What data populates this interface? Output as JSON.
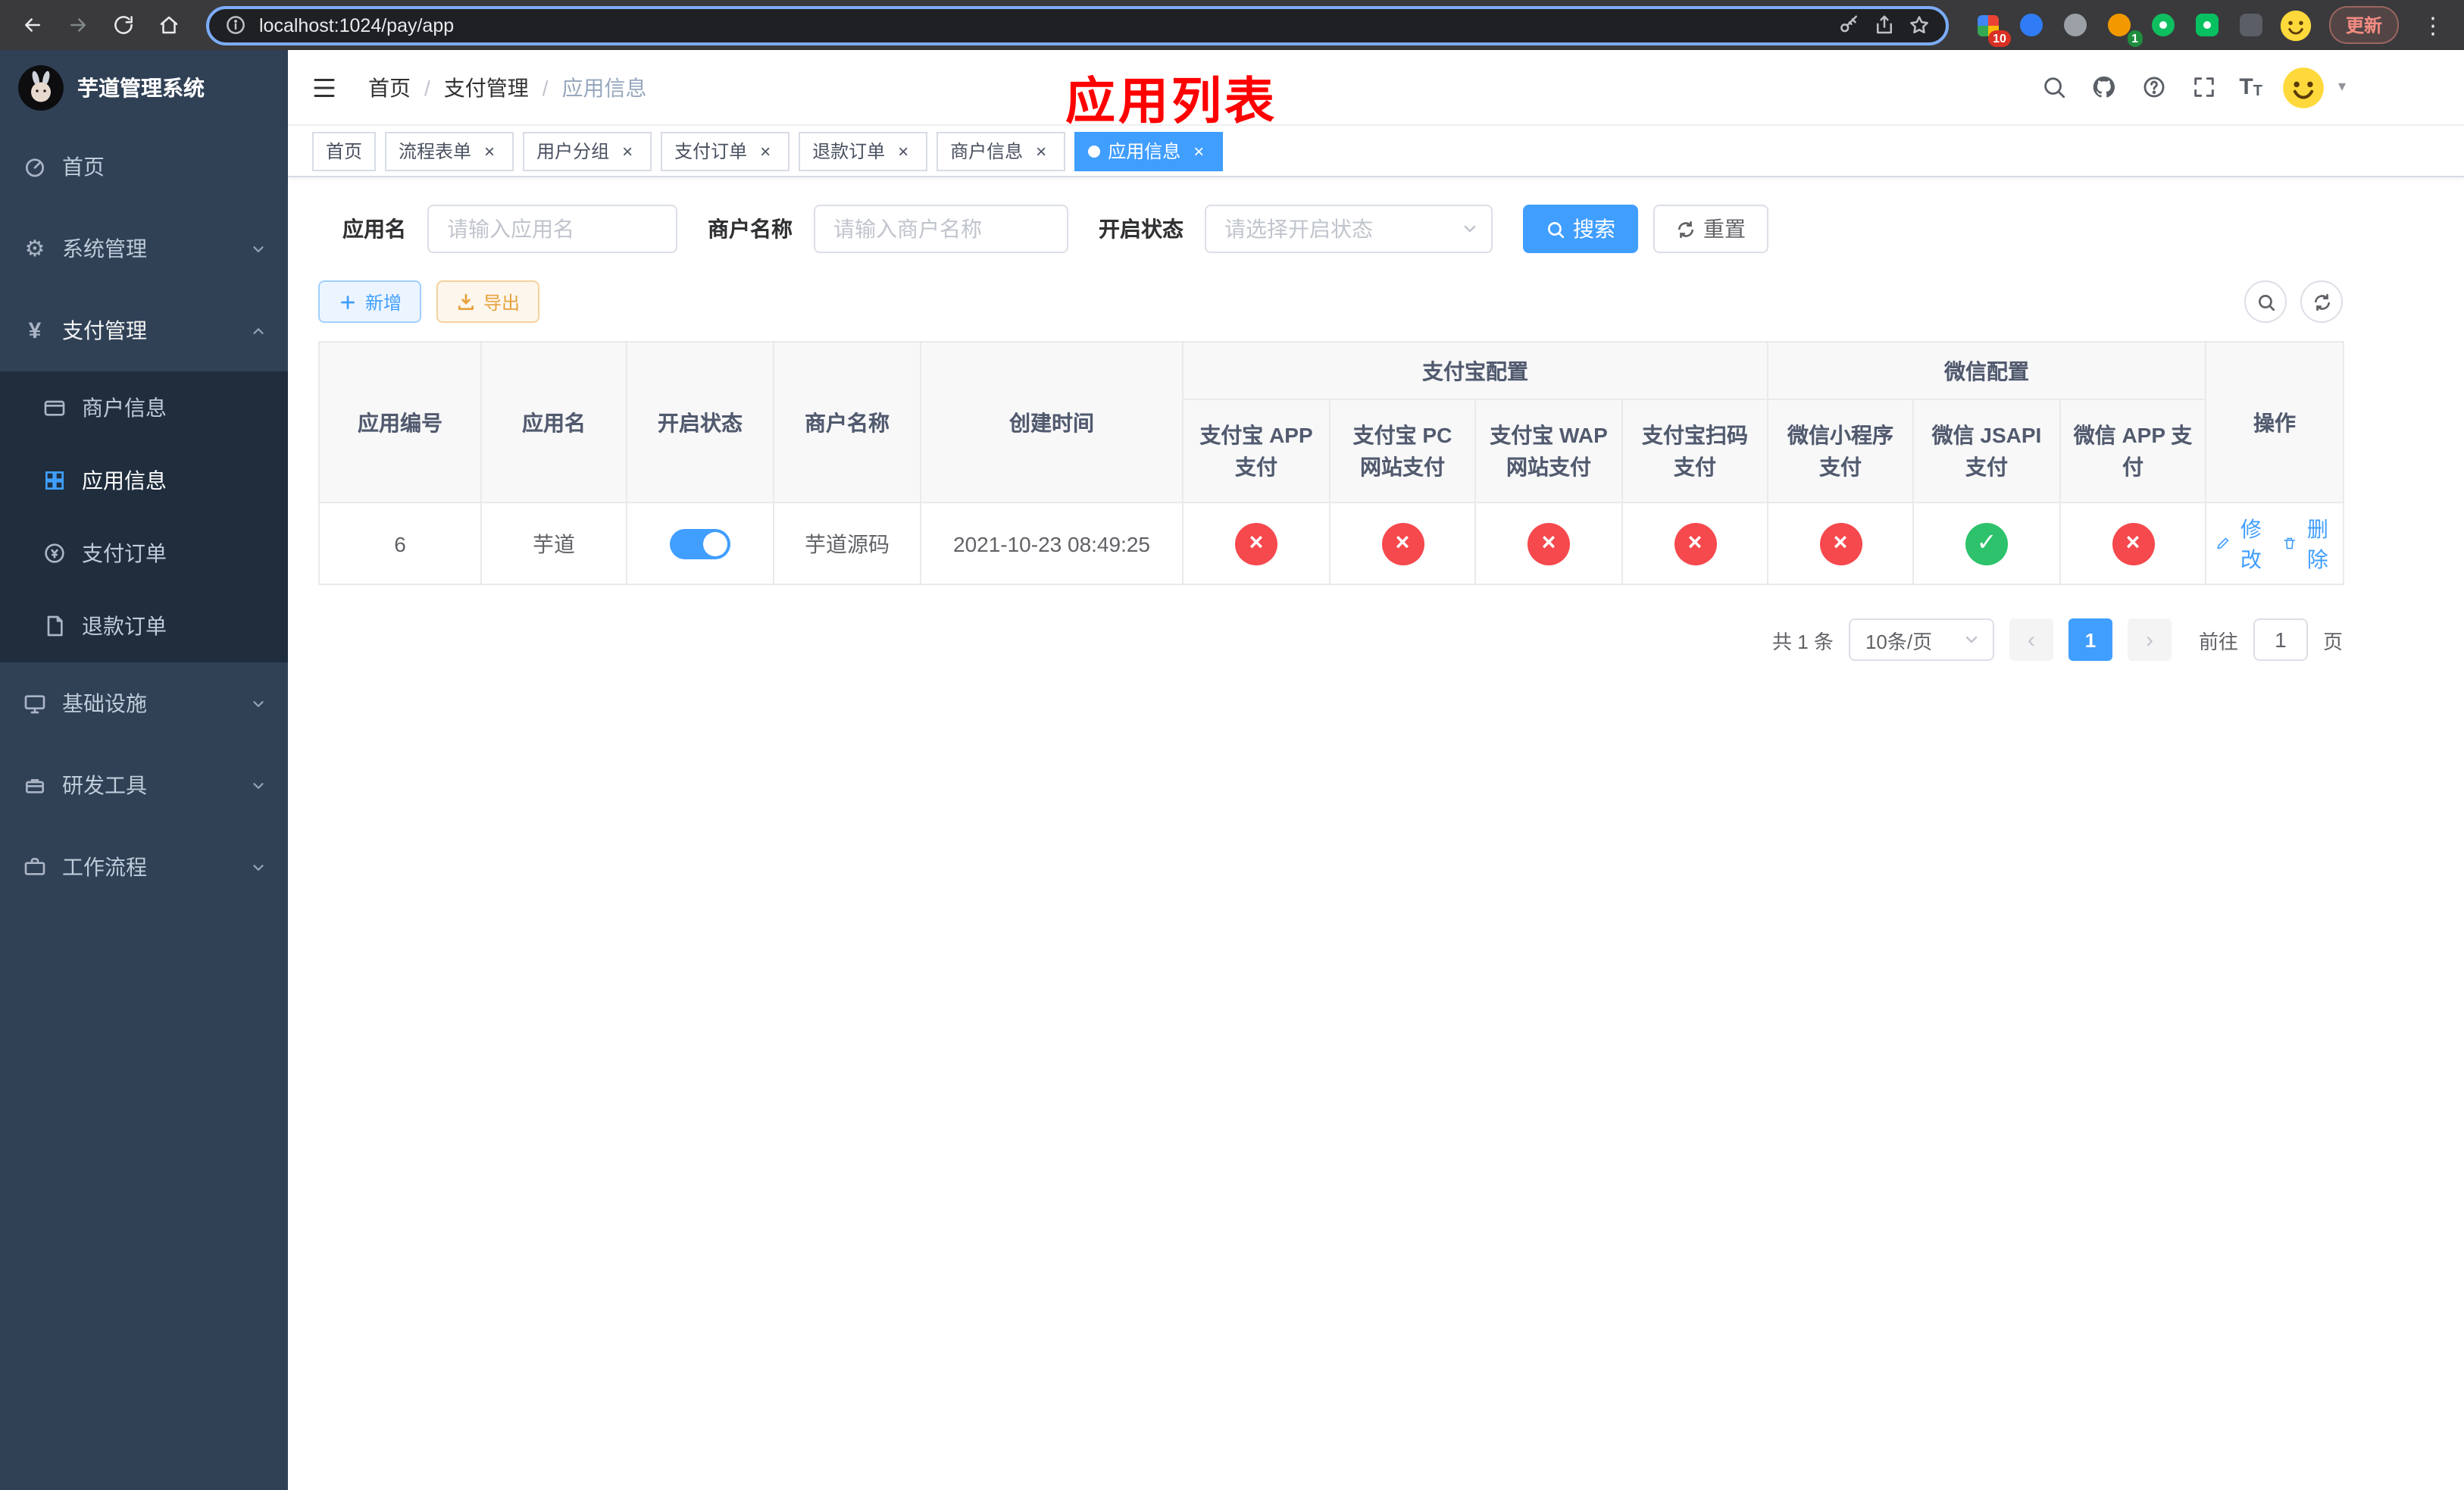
{
  "colors": {
    "primary": "#409eff",
    "danger": "#f5494d",
    "success": "#2dc26b",
    "warning": "#e6a23c",
    "title_red": "#ff0000",
    "sidebar_bg": "#304156",
    "submenu_bg": "#1f2d3d",
    "chrome_bg": "#3a3a3c"
  },
  "browser": {
    "url": "localhost:1024/pay/app",
    "update_label": "更新",
    "ext_badge_red": "10",
    "ext_badge_green": "1"
  },
  "icons": {
    "gear": "⚙",
    "yen": "¥",
    "close": "×",
    "check": "✓",
    "kebab": "⋮",
    "prev": "‹",
    "next": "›",
    "caret_down": "▾",
    "font_size_big": "T",
    "font_size_small": "T"
  },
  "sidebar": {
    "title": "芋道管理系统",
    "menu": [
      {
        "label": "首页"
      },
      {
        "label": "系统管理"
      },
      {
        "label": "支付管理"
      },
      {
        "label": "商户信息"
      },
      {
        "label": "应用信息"
      },
      {
        "label": "支付订单"
      },
      {
        "label": "退款订单"
      },
      {
        "label": "基础设施"
      },
      {
        "label": "研发工具"
      },
      {
        "label": "工作流程"
      }
    ]
  },
  "header": {
    "breadcrumb": [
      "首页",
      "支付管理",
      "应用信息"
    ],
    "separator": "/",
    "page_title": "应用列表"
  },
  "tabs": [
    {
      "label": "首页"
    },
    {
      "label": "流程表单"
    },
    {
      "label": "用户分组"
    },
    {
      "label": "支付订单"
    },
    {
      "label": "退款订单"
    },
    {
      "label": "商户信息"
    },
    {
      "label": "应用信息"
    }
  ],
  "filters": {
    "app_name_label": "应用名",
    "app_name_placeholder": "请输入应用名",
    "merchant_label": "商户名称",
    "merchant_placeholder": "请输入商户名称",
    "status_label": "开启状态",
    "status_placeholder": "请选择开启状态",
    "search_label": "搜索",
    "reset_label": "重置"
  },
  "toolbar": {
    "add_label": "新增",
    "export_label": "导出"
  },
  "table": {
    "headers": {
      "app_id": "应用编号",
      "app_name": "应用名",
      "status": "开启状态",
      "merchant": "商户名称",
      "created": "创建时间",
      "alipay_group": "支付宝配置",
      "wechat_group": "微信配置",
      "alipay_cols": [
        "支付宝 APP 支付",
        "支付宝 PC 网站支付",
        "支付宝 WAP 网站支付",
        "支付宝扫码支付"
      ],
      "wechat_cols": [
        "微信小程序支付",
        "微信 JSAPI 支付",
        "微信 APP 支付"
      ],
      "actions": "操作"
    },
    "row": {
      "app_id": "6",
      "app_name": "芋道",
      "enabled": "on",
      "merchant": "芋道源码",
      "created": "2021-10-23 08:49:25",
      "statuses": [
        "error",
        "error",
        "error",
        "error",
        "error",
        "success",
        "error"
      ],
      "edit_label": "修改",
      "delete_label": "删除"
    }
  },
  "pagination": {
    "total": "共 1 条",
    "page_size": "10条/页",
    "current_page": "1",
    "goto_label": "前往",
    "goto_value": "1",
    "goto_suffix": "页"
  }
}
